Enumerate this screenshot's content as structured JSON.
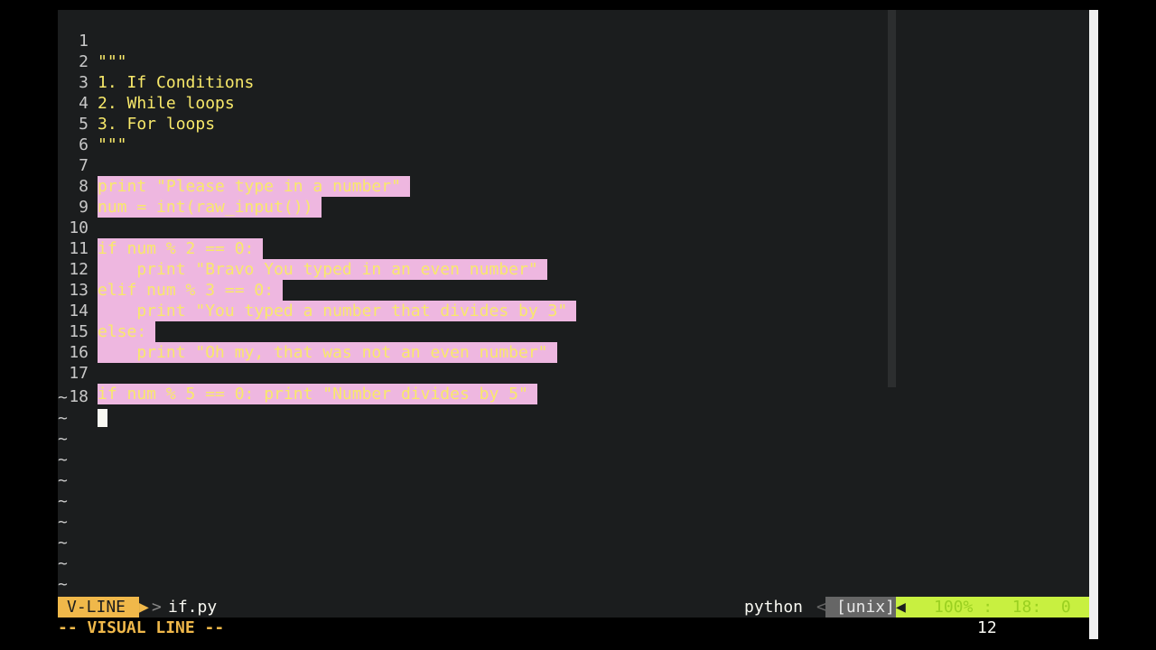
{
  "editor": {
    "lines": [
      {
        "num": "1",
        "text": "\"\"\""
      },
      {
        "num": "2",
        "text": "1. If Conditions"
      },
      {
        "num": "3",
        "text": "2. While loops"
      },
      {
        "num": "4",
        "text": "3. For loops"
      },
      {
        "num": "5",
        "text": "\"\"\""
      },
      {
        "num": "6",
        "text": ""
      },
      {
        "num": "7",
        "text": "print \"Please type in a number\""
      },
      {
        "num": "8",
        "text": "num = int(raw_input())"
      },
      {
        "num": "9",
        "text": ""
      },
      {
        "num": "10",
        "text": "if num % 2 == 0:"
      },
      {
        "num": "11",
        "text": "    print \"Bravo You typed in an even number\""
      },
      {
        "num": "12",
        "text": "elif num % 3 == 0:"
      },
      {
        "num": "13",
        "text": "    print \"You typed a number that divides by 3\""
      },
      {
        "num": "14",
        "text": "else:"
      },
      {
        "num": "15",
        "text": "    print \"Oh my, that was not an even number\""
      },
      {
        "num": "16",
        "text": ""
      },
      {
        "num": "17",
        "text": "if num % 5 == 0: print \"Number divides by 5\""
      },
      {
        "num": "18",
        "text": ""
      }
    ],
    "tilde": "~"
  },
  "statusline": {
    "mode": "V-LINE",
    "filename": "if.py",
    "filetype": "python",
    "fileformat": "[unix]",
    "percent": "100%",
    "line": "18",
    "column": "0"
  },
  "cmdline": {
    "mode_text": "-- VISUAL LINE --",
    "showcmd": "12"
  },
  "colors": {
    "background": "#1b1d1e",
    "selection": "#eeb7e0",
    "mode_accent": "#f0b84a",
    "position_accent": "#c8f040"
  }
}
